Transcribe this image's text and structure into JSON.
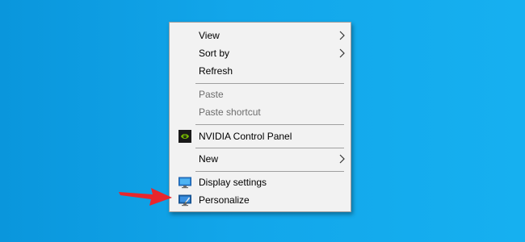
{
  "context_menu": {
    "items": [
      {
        "label": "View",
        "has_submenu": true,
        "enabled": true
      },
      {
        "label": "Sort by",
        "has_submenu": true,
        "enabled": true
      },
      {
        "label": "Refresh",
        "enabled": true
      },
      {
        "label": "Paste",
        "enabled": false
      },
      {
        "label": "Paste shortcut",
        "enabled": false
      },
      {
        "label": "NVIDIA Control Panel",
        "icon": "nvidia-icon",
        "enabled": true
      },
      {
        "label": "New",
        "has_submenu": true,
        "enabled": true
      },
      {
        "label": "Display settings",
        "icon": "display-icon",
        "enabled": true
      },
      {
        "label": "Personalize",
        "icon": "personalize-icon",
        "enabled": true
      }
    ]
  },
  "colors": {
    "desktop": "#12a6ea",
    "menu_bg": "#f2f2f2",
    "separator": "#a0a0a0",
    "disabled_text": "#6d6d6d",
    "arrow": "#e8262c"
  }
}
